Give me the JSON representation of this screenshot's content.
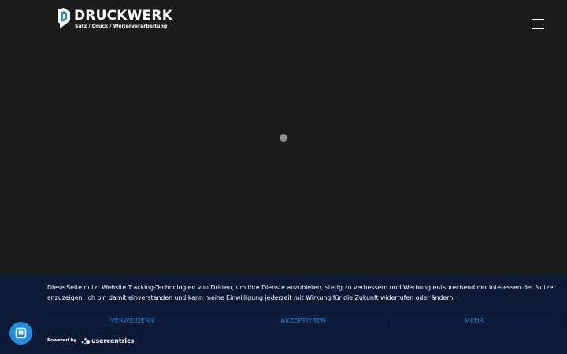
{
  "header": {
    "brand": "DRUCKWERK",
    "tagline": "Satz / Druck / Weiterverarbeitung",
    "menu_icon": "hamburger-menu-icon"
  },
  "loader": {
    "icon": "loading-dot-icon"
  },
  "consent": {
    "text": "Diese Seite nutzt Website Tracking-Technologien von Dritten, um ihre Dienste anzubieten, stetig zu verbessern und Werbung entsprechend der Interessen der Nutzer anzuzeigen. Ich bin damit einverstanden und kann meine Einwilligung jederzeit mit Wirkung für die Zukunft widerrufen oder ändern.",
    "buttons": {
      "deny": "VERWEIGERN",
      "accept": "AKZEPTIEREN",
      "more": "MEHR"
    },
    "powered_by": "Powered by",
    "provider": "usercentrics"
  },
  "fab": {
    "icon": "privacy-settings-icon"
  },
  "colors": {
    "page_bg": "#1b1b1b",
    "banner_bg": "#0c1a35",
    "button_text": "#2f79c4",
    "fab_bg": "#1e8fe0",
    "logo_accent": "#2a8fdc"
  }
}
